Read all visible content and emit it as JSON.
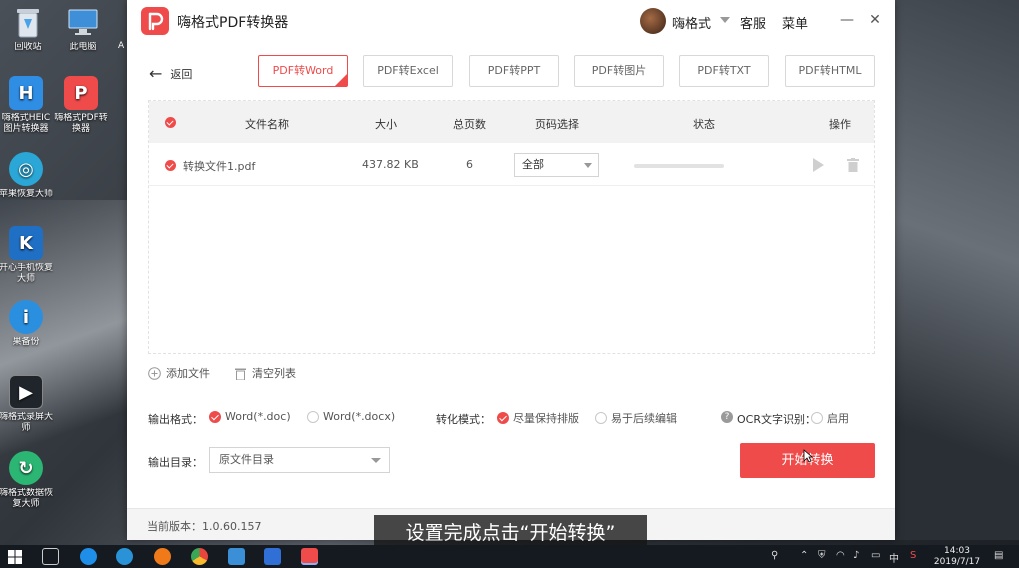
{
  "desktop": {
    "icons": [
      {
        "label": "回收站",
        "icon": "recycle-bin-icon"
      },
      {
        "label": "此电脑",
        "icon": "computer-icon"
      },
      {
        "label": "嗨格式HEIC图片转换器",
        "icon": "heic-converter-icon"
      },
      {
        "label": "嗨格式PDF转换器",
        "icon": "pdf-converter-icon"
      },
      {
        "label": "苹果恢复大师",
        "icon": "apple-recovery-icon"
      },
      {
        "label": "开心手机恢复大师",
        "icon": "phone-recovery-icon"
      },
      {
        "label": "果备份",
        "icon": "backup-icon"
      },
      {
        "label": "嗨格式录屏大师",
        "icon": "screen-recorder-icon"
      },
      {
        "label": "嗨格式数据恢复大师",
        "icon": "data-recovery-icon"
      },
      {
        "label": "A"
      }
    ]
  },
  "app": {
    "title": "嗨格式PDF转换器",
    "user": "嗨格式",
    "support": "客服",
    "menu": "菜单",
    "minimize_glyph": "—",
    "close_glyph": "✕",
    "back_label": "返回",
    "tabs": [
      {
        "label": "PDF转Word",
        "active": true
      },
      {
        "label": "PDF转Excel",
        "active": false
      },
      {
        "label": "PDF转PPT",
        "active": false
      },
      {
        "label": "PDF转图片",
        "active": false
      },
      {
        "label": "PDF转TXT",
        "active": false
      },
      {
        "label": "PDF转HTML",
        "active": false
      }
    ],
    "table": {
      "headers": {
        "name": "文件名称",
        "size": "大小",
        "pages": "总页数",
        "page_select": "页码选择",
        "status": "状态",
        "actions": "操作"
      },
      "rows": [
        {
          "name": "转换文件1.pdf",
          "size": "437.82 KB",
          "pages": "6",
          "page_select": "全部",
          "progress": 0
        }
      ]
    },
    "add_file": "添加文件",
    "clear_list": "清空列表",
    "output_format_label": "输出格式：",
    "formats": [
      {
        "label": "Word(*.doc)",
        "selected": true
      },
      {
        "label": "Word(*.docx)",
        "selected": false
      }
    ],
    "mode_label": "转化模式：",
    "modes": [
      {
        "label": "尽量保持排版",
        "selected": true
      },
      {
        "label": "易于后续编辑",
        "selected": false
      }
    ],
    "ocr_label": "OCR文字识别：",
    "ocr_option": "启用",
    "ocr_enabled": false,
    "output_dir_label": "输出目录：",
    "output_dir_value": "原文件目录",
    "start_button": "开始转换",
    "version": "当前版本：1.0.60.157"
  },
  "subtitle": "设置完成点击“开始转换”",
  "taskbar": {
    "time": "14:03",
    "date": "2019/7/17",
    "ime": "中",
    "colors": {
      "accent": "#ef4b4b",
      "taskbar": "#151a20"
    }
  }
}
